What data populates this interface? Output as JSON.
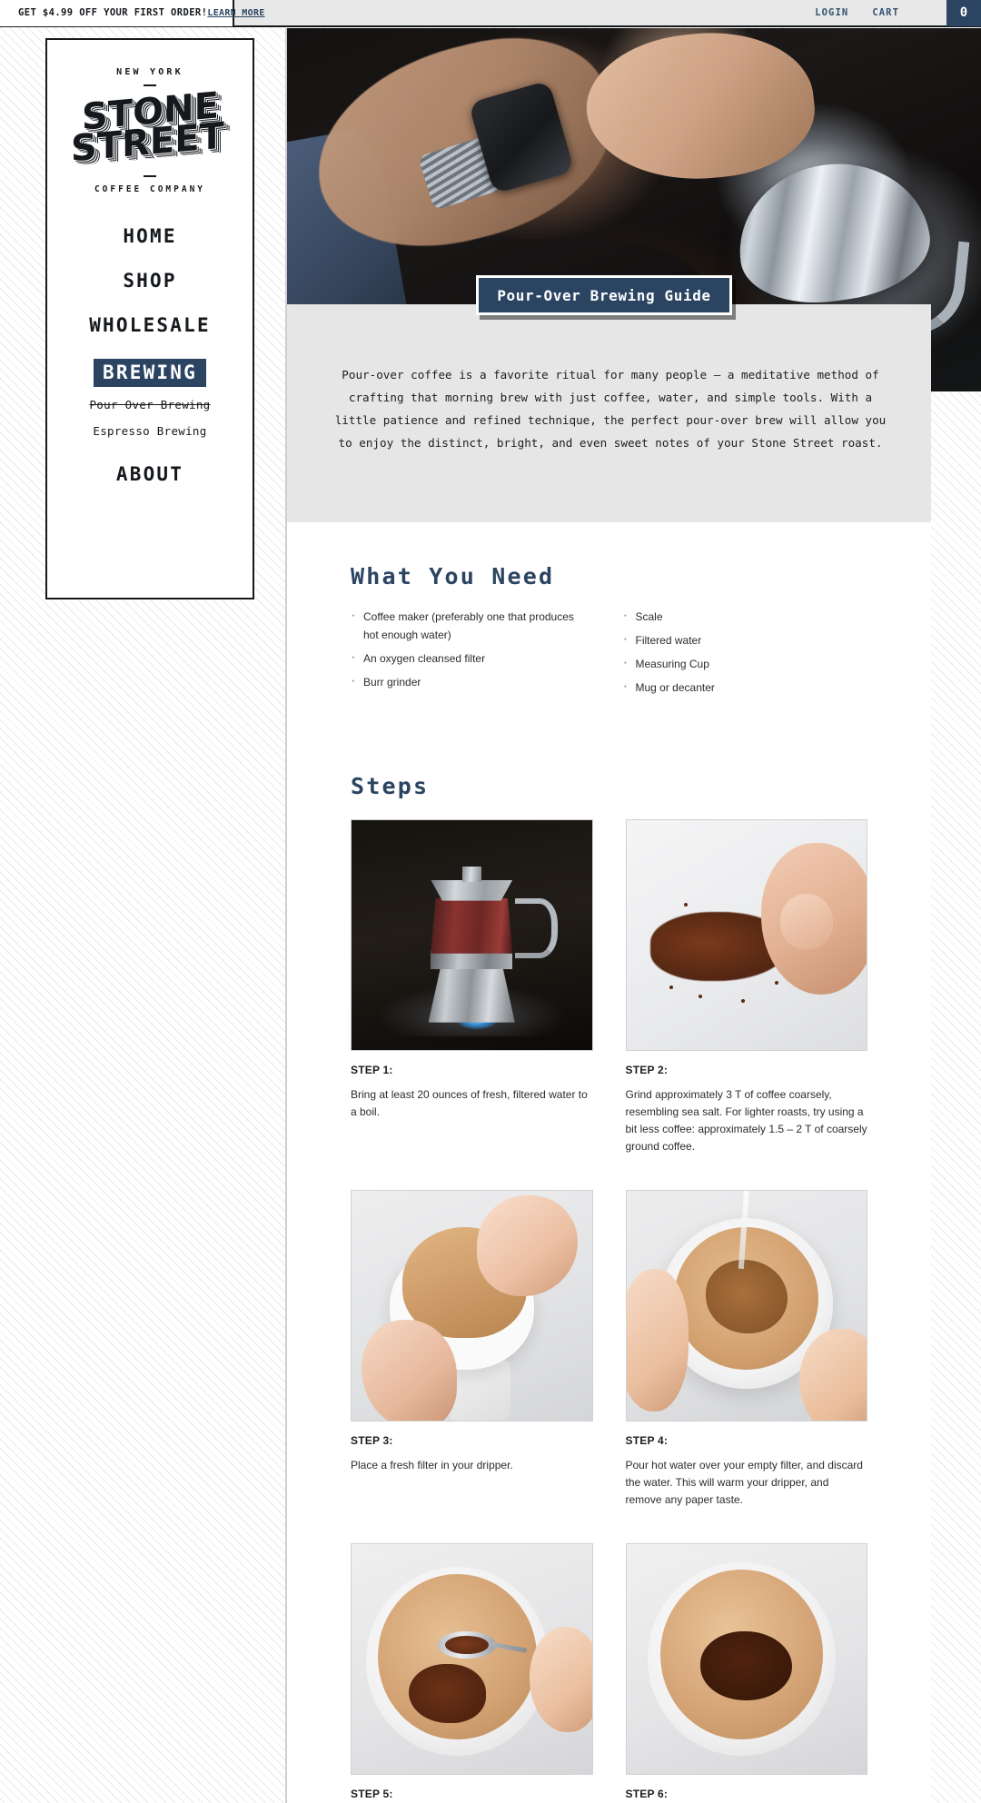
{
  "topbar": {
    "promo_text": "GET $4.99 OFF YOUR FIRST ORDER!",
    "promo_link": "LEARN MORE",
    "login": "LOGIN",
    "cart": "CART",
    "cart_count": "0",
    "accent_color": "#2b4462"
  },
  "logo": {
    "top": "NEW YORK",
    "line1": "STONE",
    "line2": "STREET",
    "bottom": "COFFEE COMPANY"
  },
  "nav": {
    "items": [
      {
        "label": "HOME",
        "active": false
      },
      {
        "label": "SHOP",
        "active": false
      },
      {
        "label": "WHOLESALE",
        "active": false
      },
      {
        "label": "BREWING",
        "active": true
      },
      {
        "label": "ABOUT",
        "active": false
      }
    ],
    "subitems": [
      {
        "label": "Pour Over Brewing",
        "current": true
      },
      {
        "label": "Espresso Brewing",
        "current": false
      }
    ]
  },
  "hero": {
    "image_alt": "hands-pouring-gooseneck-kettle",
    "title": "Pour-Over Brewing Guide"
  },
  "intro": {
    "paragraph": "Pour-over coffee is a favorite ritual for many people — a meditative method of crafting that morning brew with just coffee, water, and simple tools. With a little patience and refined technique, the perfect pour-over brew will allow you to enjoy the distinct, bright, and even sweet notes of your Stone Street roast."
  },
  "what_you_need": {
    "heading": "What You Need",
    "column_left": [
      "Coffee maker (preferably one that produces hot enough water)",
      "An oxygen cleansed filter",
      "Burr grinder"
    ],
    "column_right": [
      "Scale",
      "Filtered water",
      "Measuring Cup",
      "Mug or decanter"
    ]
  },
  "steps": {
    "heading": "Steps",
    "items": [
      {
        "label": "STEP 1:",
        "text": "Bring at least 20 ounces of fresh, filtered water to a boil.",
        "image_alt": "moka-pot-on-gas-stove"
      },
      {
        "label": "STEP 2:",
        "text": "Grind approximately 3 T of coffee coarsely, resembling sea salt. For lighter roasts, try using a bit less coffee: approximately 1.5 – 2 T of coarsely ground coffee.",
        "image_alt": "hand-pinching-ground-coffee"
      },
      {
        "label": "STEP 3:",
        "text": "Place a fresh filter in your dripper.",
        "image_alt": "placing-paper-filter-in-dripper"
      },
      {
        "label": "STEP 4:",
        "text": "Pour hot water over your empty filter, and discard the water. This will warm your dripper, and remove any paper taste.",
        "image_alt": "rinsing-filter-with-hot-water"
      },
      {
        "label": "STEP 5:",
        "text": "",
        "image_alt": "scooping-coffee-grounds-into-filter"
      },
      {
        "label": "STEP 6:",
        "text": "",
        "image_alt": "bloomed-coffee-bed-in-filter"
      }
    ]
  }
}
